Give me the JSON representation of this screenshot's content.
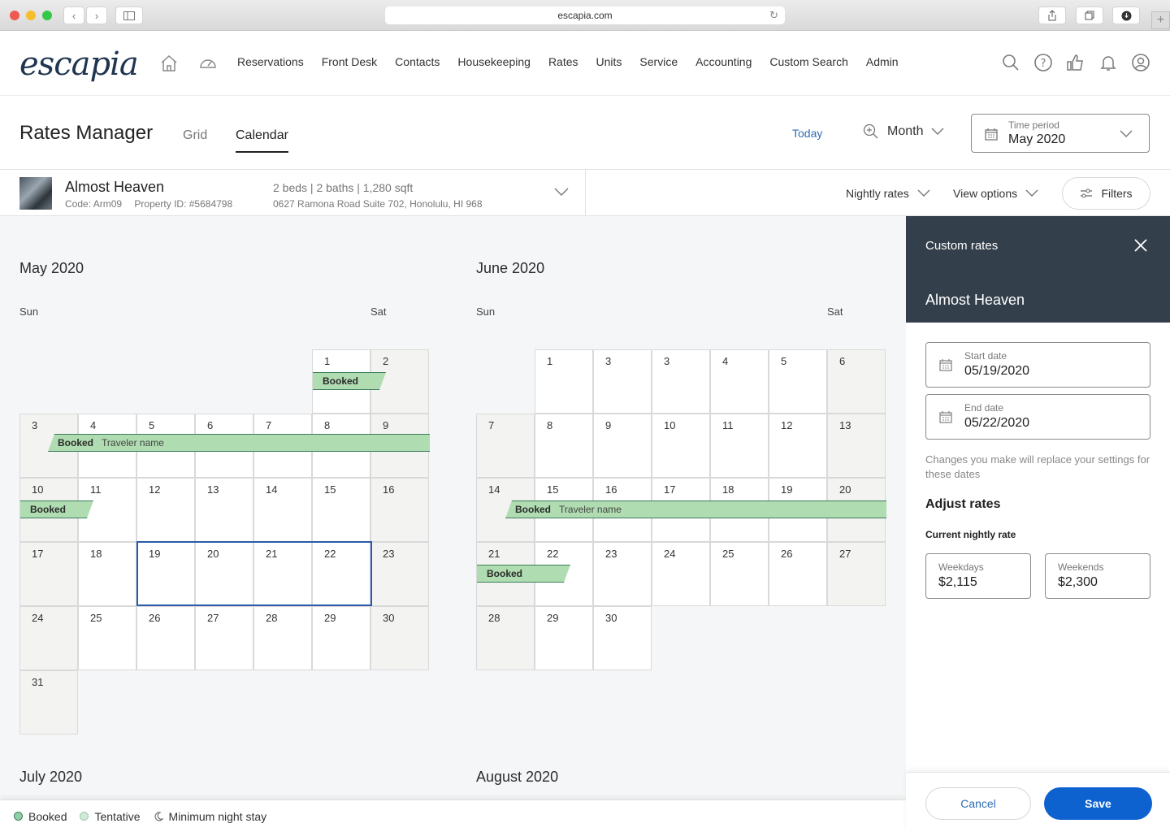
{
  "browser": {
    "url": "escapia.com"
  },
  "nav": {
    "logo": "escapia",
    "links": [
      "Reservations",
      "Front Desk",
      "Contacts",
      "Housekeeping",
      "Rates",
      "Units",
      "Service",
      "Accounting",
      "Custom Search",
      "Admin"
    ]
  },
  "header": {
    "title": "Rates Manager",
    "tabs": [
      {
        "label": "Grid",
        "active": false
      },
      {
        "label": "Calendar",
        "active": true
      }
    ],
    "today": "Today",
    "zoom_level": "Month",
    "time_period_label": "Time period",
    "time_period_value": "May 2020"
  },
  "property": {
    "name": "Almost Heaven",
    "code": "Code: Arm09",
    "property_id": "Property ID: #5684798",
    "specs": "2 beds | 2 baths | 1,280 sqft",
    "address": "0627 Ramona Road Suite 702, Honolulu, HI 968"
  },
  "toolbar": {
    "nightly_rates": "Nightly rates",
    "view_options": "View options",
    "filters": "Filters"
  },
  "calendar": {
    "dow_first": "Sun",
    "dow_last": "Sat",
    "months": [
      {
        "title": "May 2020",
        "days": [
          "1",
          "2",
          "3",
          "4",
          "5",
          "6",
          "7",
          "8",
          "9",
          "10",
          "11",
          "12",
          "13",
          "14",
          "15",
          "16",
          "17",
          "18",
          "19",
          "20",
          "21",
          "22",
          "23",
          "24",
          "25",
          "26",
          "27",
          "28",
          "29",
          "30",
          "31"
        ],
        "bookings": [
          {
            "status": "Booked",
            "guest": ""
          },
          {
            "status": "Booked",
            "guest": "Traveler name"
          },
          {
            "status": "Booked",
            "guest": ""
          }
        ],
        "selected_range": "19–22"
      },
      {
        "title": "June 2020",
        "days": [
          "1",
          "3",
          "3",
          "4",
          "5",
          "6",
          "7",
          "8",
          "9",
          "10",
          "11",
          "12",
          "13",
          "14",
          "15",
          "16",
          "17",
          "18",
          "19",
          "20",
          "21",
          "22",
          "23",
          "24",
          "25",
          "26",
          "27",
          "28",
          "29",
          "30"
        ],
        "bookings": [
          {
            "status": "Booked",
            "guest": "Traveler name"
          },
          {
            "status": "Booked",
            "guest": ""
          }
        ]
      }
    ],
    "next_months": [
      "July 2020",
      "August 2020"
    ]
  },
  "legend": {
    "items": [
      "Booked",
      "Tentative",
      "Minimum night stay"
    ]
  },
  "panel": {
    "title": "Custom rates",
    "property": "Almost Heaven",
    "start_label": "Start date",
    "start_value": "05/19/2020",
    "end_label": "End date",
    "end_value": "05/22/2020",
    "note": "Changes you make will replace your settings for these dates",
    "adjust_heading": "Adjust rates",
    "current_label": "Current nightly rate",
    "weekdays_label": "Weekdays",
    "weekdays_value": "$2,115",
    "weekends_label": "Weekends",
    "weekends_value": "$2,300",
    "cancel": "Cancel",
    "save": "Save"
  },
  "colors": {
    "accent": "#0e62d0",
    "link": "#2f6db5",
    "panel_header": "#333f4b",
    "booked_fill": "#afdcb0",
    "booked_border": "#3d7d5c",
    "selection": "#2a5aa8"
  }
}
